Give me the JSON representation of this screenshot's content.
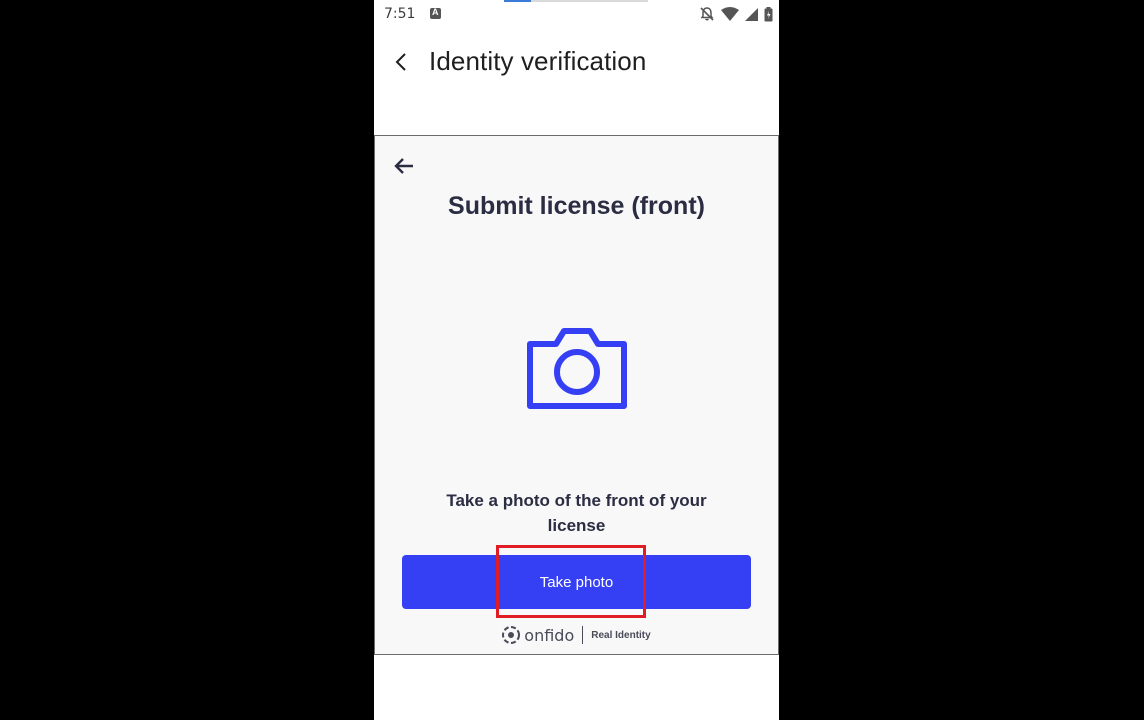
{
  "status_bar": {
    "time": "7:51",
    "icons": [
      "keyboard-a-icon",
      "notifications-off-icon",
      "wifi-icon",
      "signal-icon",
      "battery-icon"
    ],
    "progress_fraction": 0.19
  },
  "app_bar": {
    "title": "Identity verification",
    "back_icon": "chevron-left-icon"
  },
  "web": {
    "back_icon": "arrow-left-icon",
    "heading": "Submit license (front)",
    "camera_icon": "camera-icon",
    "instruction": "Take a photo of the front of your license",
    "button_label": "Take photo",
    "footer": {
      "brand": "onfido",
      "tagline": "Real Identity"
    }
  },
  "colors": {
    "accent": "#353ff4",
    "heading_text": "#2b2d42",
    "highlight": "#e01d24",
    "background": "#000000"
  }
}
